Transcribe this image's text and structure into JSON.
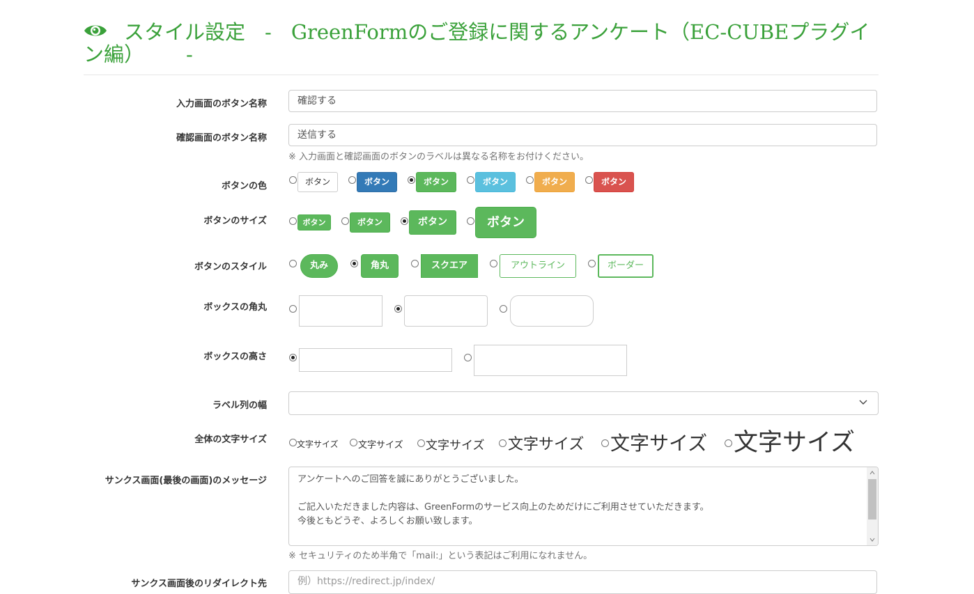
{
  "header": {
    "title_main": "スタイル設定",
    "title_sep1": "-",
    "title_form": "GreenFormのご登録に関するアンケート（EC-CUBEプラグイン編）",
    "title_sep2": "-",
    "icon": "eye-icon",
    "color": "#3aa13a"
  },
  "fields": {
    "input_button_name": {
      "label": "入力画面のボタン名称",
      "value": "確認する"
    },
    "confirm_button_name": {
      "label": "確認画面のボタン名称",
      "value": "送信する"
    },
    "button_name_help": "※ 入力画面と確認画面のボタンのラベルは異なる名称をお付けください。",
    "button_color": {
      "label": "ボタンの色",
      "options": [
        {
          "text": "ボタン",
          "color": "#ffffff"
        },
        {
          "text": "ボタン",
          "color": "#337ab7"
        },
        {
          "text": "ボタン",
          "color": "#5cb85c"
        },
        {
          "text": "ボタン",
          "color": "#5bc0de"
        },
        {
          "text": "ボタン",
          "color": "#f0ad4e"
        },
        {
          "text": "ボタン",
          "color": "#d9534f"
        }
      ],
      "selected_index": 2
    },
    "button_size": {
      "label": "ボタンのサイズ",
      "options": [
        "ボタン",
        "ボタン",
        "ボタン",
        "ボタン"
      ],
      "selected_index": 2
    },
    "button_style": {
      "label": "ボタンのスタイル",
      "options": [
        "丸み",
        "角丸",
        "スクエア",
        "アウトライン",
        "ボーダー"
      ],
      "selected_index": 1
    },
    "box_corner": {
      "label": "ボックスの角丸",
      "selected_index": 1
    },
    "box_height": {
      "label": "ボックスの高さ",
      "selected_index": 0
    },
    "label_width": {
      "label": "ラベル列の幅",
      "value": ""
    },
    "font_size": {
      "label": "全体の文字サイズ",
      "options": [
        "文字サイズ",
        "文字サイズ",
        "文字サイズ",
        "文字サイズ",
        "文字サイズ",
        "文字サイズ"
      ]
    },
    "thanks_message": {
      "label": "サンクス画面(最後の画面)のメッセージ",
      "lines": [
        "アンケートへのご回答を誠にありがとうございました。",
        "",
        "ご記入いただきました内容は、GreenFormのサービス向上のためだけにご利用させていただきます。",
        "今後ともどうぞ、よろしくお願い致します。"
      ],
      "help": "※ セキュリティのため半角で「mail:」という表記はご利用になれません。"
    },
    "redirect_url": {
      "label": "サンクス画面後のリダイレクト先",
      "placeholder": "例）https://redirect.jp/index/"
    }
  }
}
